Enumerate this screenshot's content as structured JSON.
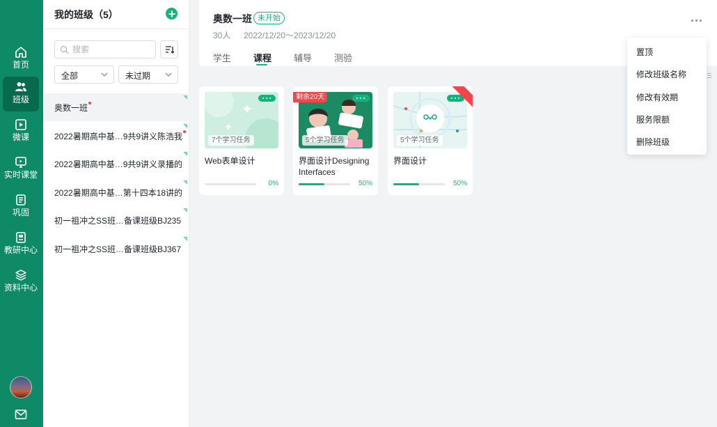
{
  "nav": {
    "items": [
      {
        "label": "首页",
        "icon": "home-icon"
      },
      {
        "label": "班级",
        "icon": "class-icon"
      },
      {
        "label": "微课",
        "icon": "micro-course-icon"
      },
      {
        "label": "实时课堂",
        "icon": "live-class-icon"
      },
      {
        "label": "巩固",
        "icon": "practice-icon"
      },
      {
        "label": "教研中心",
        "icon": "research-icon"
      },
      {
        "label": "资料中心",
        "icon": "materials-icon"
      }
    ],
    "active": "班级",
    "avatar": "avatar",
    "mail_icon": "mail-icon"
  },
  "class_list": {
    "title": "我的班级（5）",
    "search_placeholder": "搜索",
    "filter_scope": "全部",
    "filter_expiry": "未过期",
    "items": [
      {
        "name": "奥数一班",
        "unread": true,
        "active": true
      },
      {
        "name": "2022暑期高中基…9共9讲义陈浩我",
        "unread": true,
        "active": false
      },
      {
        "name": "2022暑期高中基…9共9讲义录播的",
        "unread": false,
        "active": false
      },
      {
        "name": "2022暑期高中基…第十四本18讲的",
        "unread": false,
        "active": false
      },
      {
        "name": "初一祖冲之SS班…备课班级BJ235",
        "unread": false,
        "active": false
      },
      {
        "name": "初一祖冲之SS班…备课班级BJ367",
        "unread": false,
        "active": false
      }
    ]
  },
  "header": {
    "class_name": "奥数一班",
    "status": "未开始",
    "student_count": "30人",
    "date_range": "2022/12/20～2023/12/20",
    "tabs": [
      "学生",
      "课程",
      "辅导",
      "测验"
    ],
    "active_tab": "课程"
  },
  "courses": [
    {
      "title": "Web表单设计",
      "tasks": "7个学习任务",
      "progress_text": "0%",
      "progress": 0,
      "badge": ""
    },
    {
      "title": "界面设计Designing Interfaces",
      "tasks": "5个学习任务",
      "progress_text": "50%",
      "progress": 0.5,
      "badge": "剩余20天"
    },
    {
      "title": "界面设计",
      "tasks": "5个学习任务",
      "progress_text": "50%",
      "progress": 0.5,
      "badge": ""
    }
  ],
  "menu": {
    "items": [
      "置顶",
      "修改班级名称",
      "修改有效期",
      "服务限额",
      "删除班级"
    ]
  },
  "colors": {
    "nav_bg": "#0e8a66",
    "accent": "#14b37d",
    "alert": "#f0474b"
  }
}
